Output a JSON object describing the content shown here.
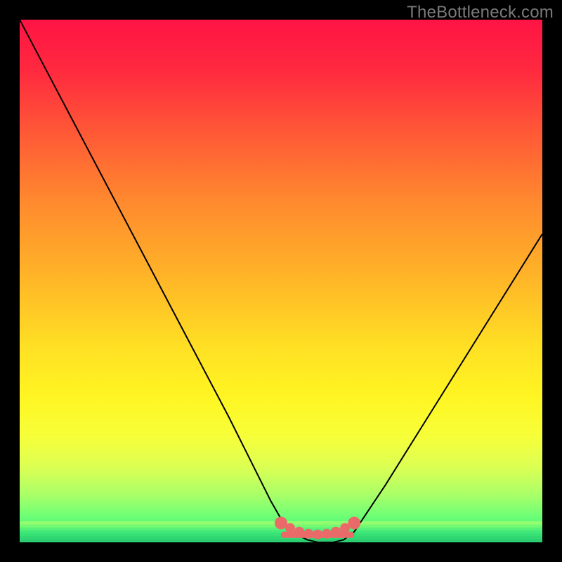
{
  "watermark": "TheBottleneck.com",
  "chart_data": {
    "type": "line",
    "title": "",
    "xlabel": "",
    "ylabel": "",
    "xlim": [
      0,
      100
    ],
    "ylim": [
      0,
      100
    ],
    "series": [
      {
        "name": "bottleneck-curve",
        "x": [
          0,
          5,
          10,
          15,
          20,
          25,
          30,
          35,
          40,
          45,
          48,
          50,
          52,
          55,
          57,
          60,
          62,
          64,
          66,
          70,
          75,
          80,
          85,
          90,
          95,
          100
        ],
        "values": [
          100,
          90.5,
          81,
          71.5,
          62,
          52.5,
          43,
          33.5,
          24,
          14,
          8,
          4.5,
          2,
          0.5,
          0,
          0,
          0.5,
          2,
          5,
          11,
          19,
          27,
          35,
          43,
          51,
          59
        ]
      }
    ],
    "highlight_band": {
      "y_from": 0,
      "y_to": 3,
      "color": "#2fe27a"
    },
    "marker_cluster": {
      "x_range": [
        50,
        64
      ],
      "y_approx": 1.5,
      "color": "#ea6a6a",
      "count": 9
    },
    "gradient_stops": [
      {
        "pos": 0.0,
        "color": "#ff1444"
      },
      {
        "pos": 0.1,
        "color": "#ff2a3f"
      },
      {
        "pos": 0.22,
        "color": "#ff5a36"
      },
      {
        "pos": 0.35,
        "color": "#ff8a2e"
      },
      {
        "pos": 0.5,
        "color": "#ffb727"
      },
      {
        "pos": 0.62,
        "color": "#ffde24"
      },
      {
        "pos": 0.72,
        "color": "#fff522"
      },
      {
        "pos": 0.8,
        "color": "#f6ff3a"
      },
      {
        "pos": 0.86,
        "color": "#d9ff55"
      },
      {
        "pos": 0.91,
        "color": "#a8ff68"
      },
      {
        "pos": 0.95,
        "color": "#6dff76"
      },
      {
        "pos": 1.0,
        "color": "#2fe27a"
      }
    ]
  }
}
